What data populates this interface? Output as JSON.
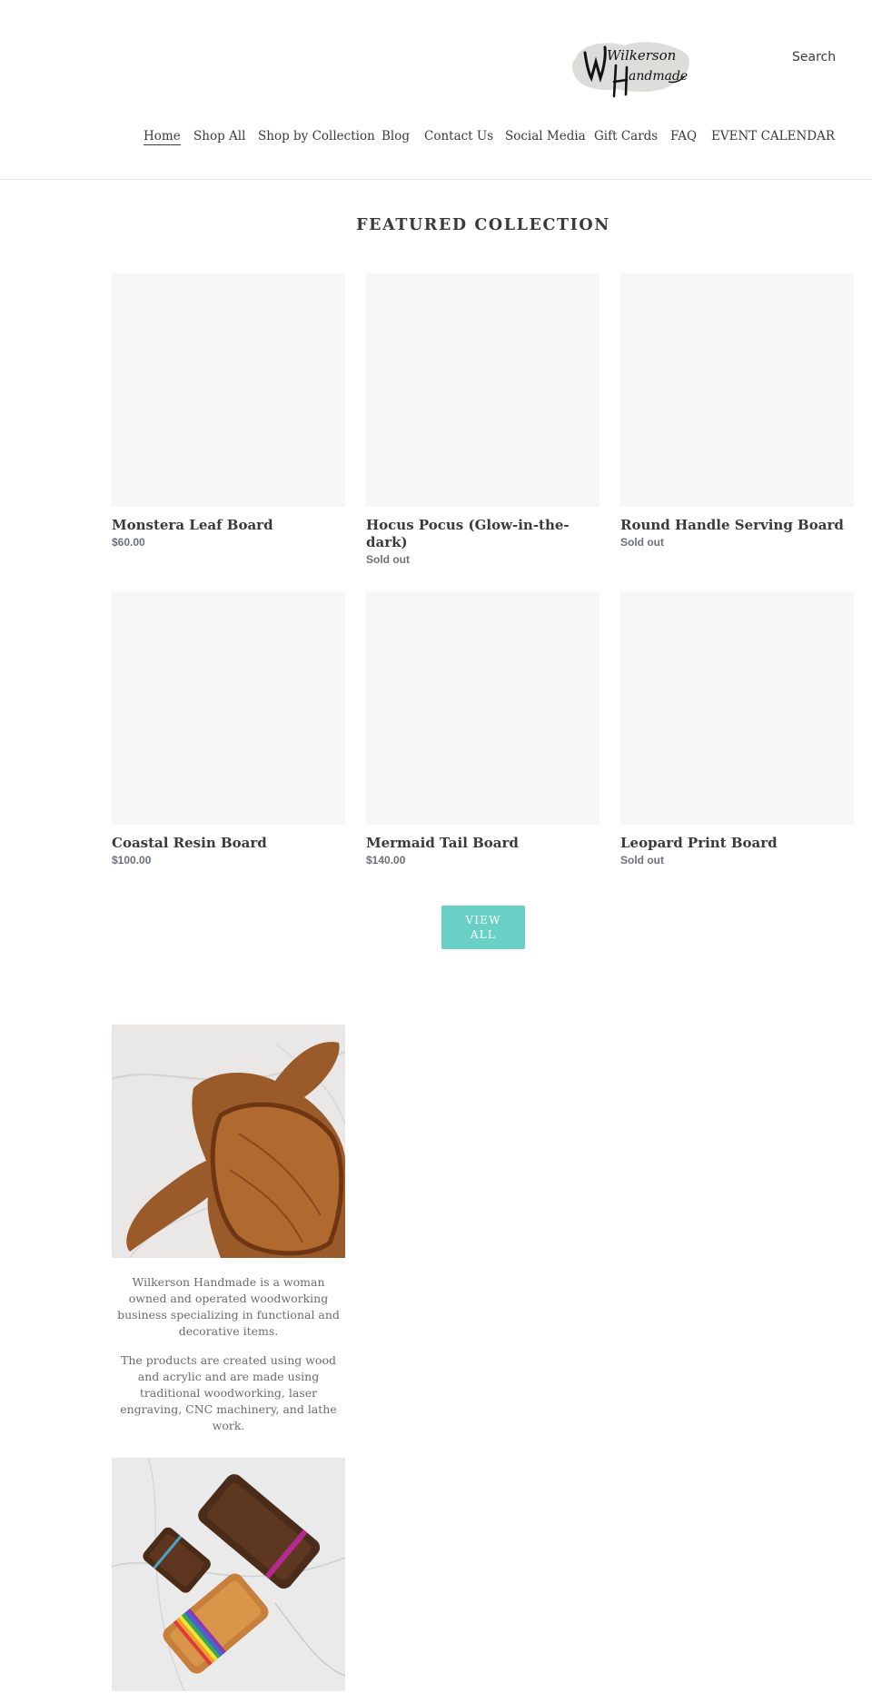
{
  "header": {
    "logo": {
      "text_line1": "Wilkerson",
      "text_line2": "Handmade"
    },
    "search_label": "Search",
    "nav": [
      {
        "label": "Home",
        "active": true
      },
      {
        "label": "Shop All"
      },
      {
        "label": "Shop by Collection"
      },
      {
        "label": "Blog"
      },
      {
        "label": "Contact Us"
      },
      {
        "label": "Social Media"
      },
      {
        "label": "Gift Cards"
      },
      {
        "label": "FAQ"
      },
      {
        "label": "EVENT CALENDAR"
      }
    ]
  },
  "featured": {
    "title": "FEATURED COLLECTION",
    "products": [
      {
        "title": "Monstera Leaf Board",
        "price": "$60.00"
      },
      {
        "title": "Hocus Pocus (Glow-in-the-dark)",
        "price": "Sold out"
      },
      {
        "title": "Round Handle Serving Board",
        "price": "Sold out"
      },
      {
        "title": "Coastal Resin Board",
        "price": "$100.00"
      },
      {
        "title": "Mermaid Tail Board",
        "price": "$140.00"
      },
      {
        "title": "Leopard Print Board",
        "price": "Sold out"
      }
    ],
    "view_all_label": "VIEW ALL"
  },
  "about": {
    "paragraphs": [
      "Wilkerson Handmade is a woman owned and operated woodworking business specializing in functional and decorative items.",
      "The products are created using wood and acrylic and are made using traditional woodworking, laser engraving, CNC machinery, and lathe work."
    ]
  },
  "colors": {
    "accent": "#69d0c6",
    "text": "#3a3a3a",
    "price": "#69727b",
    "placeholder": "#f6f6f6"
  }
}
